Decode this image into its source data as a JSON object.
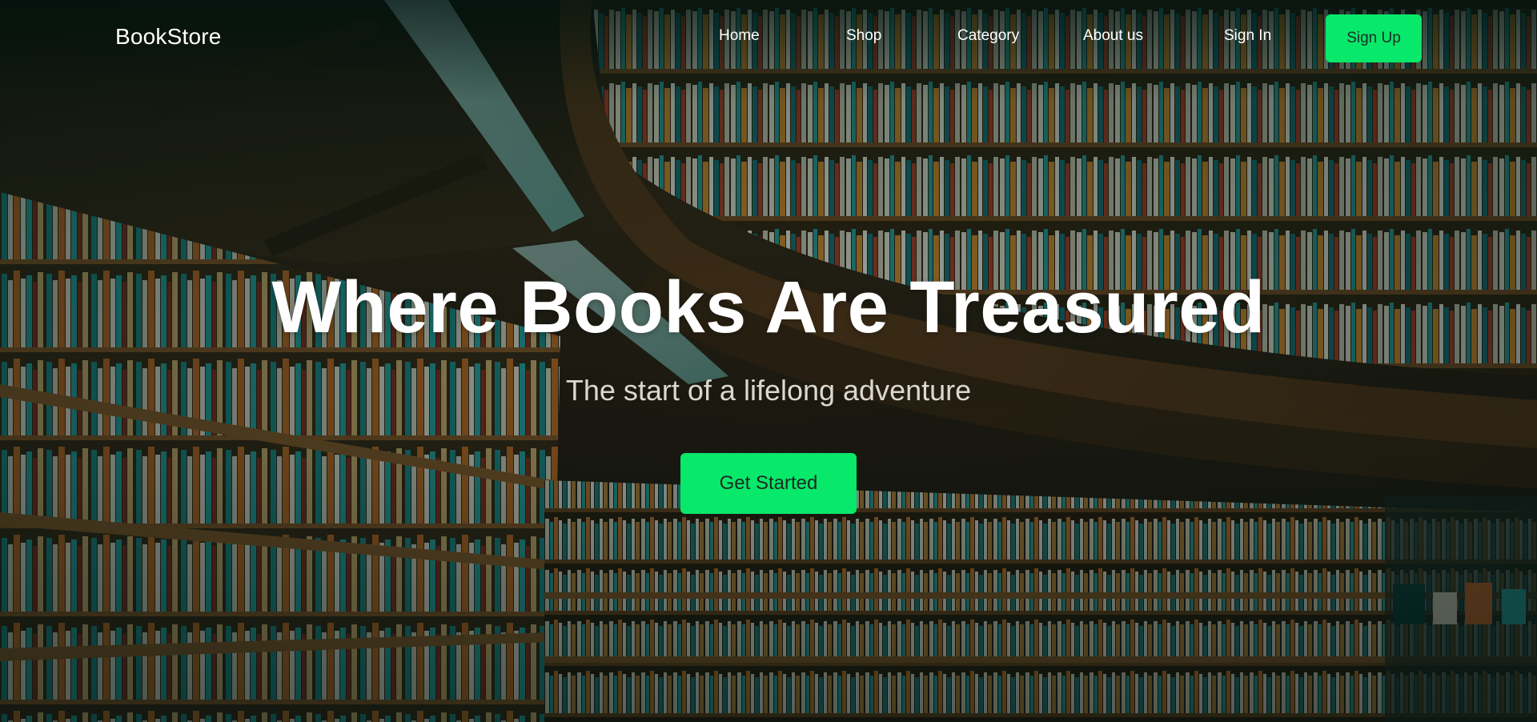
{
  "brand": {
    "logo_text": "BookStore"
  },
  "nav": {
    "links": [
      {
        "label": "Home"
      },
      {
        "label": "Shop"
      },
      {
        "label": "Category"
      },
      {
        "label": "About us"
      }
    ],
    "sign_in_label": "Sign In",
    "sign_up_label": "Sign Up"
  },
  "hero": {
    "title": "Where Books Are Treasured",
    "subtitle": "The start of a lifelong adventure",
    "cta_label": "Get Started",
    "background_image": "library-bookshelves-photo"
  },
  "colors": {
    "accent": "#08e86a",
    "text_primary": "#ffffff",
    "subtitle": "#dcd8cf"
  }
}
